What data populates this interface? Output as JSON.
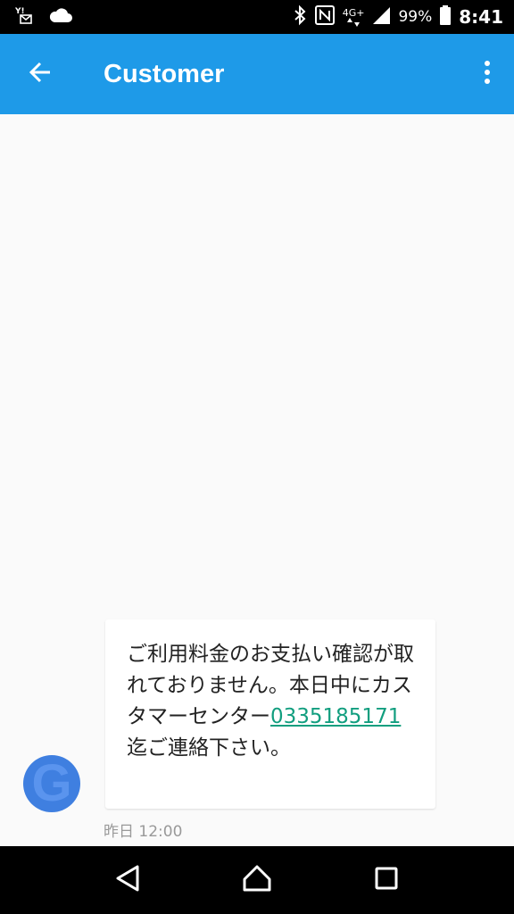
{
  "status_bar": {
    "battery_percent": "99%",
    "time": "8:41",
    "network_type": "4G+",
    "icons": [
      "yahoo-mail-icon",
      "cloud-icon",
      "bluetooth-icon",
      "nfc-icon",
      "signal-icon",
      "battery-icon"
    ]
  },
  "app_bar": {
    "title": "Customer",
    "background_color": "#1e9ae8"
  },
  "message": {
    "text_before_link": "ご利用料金のお支払い確認が取れておりません。本日中にカスタマーセンター",
    "phone_number": "0335185171",
    "text_after_link": " 迄ご連絡下さい。",
    "timestamp": "昨日 12:00",
    "link_color": "#129e7f"
  },
  "avatar": {
    "letter": "G",
    "color": "#3f7fe0"
  },
  "nav_bar": {
    "buttons": [
      "back-triangle-icon",
      "home-circle-icon",
      "recents-square-icon"
    ]
  }
}
